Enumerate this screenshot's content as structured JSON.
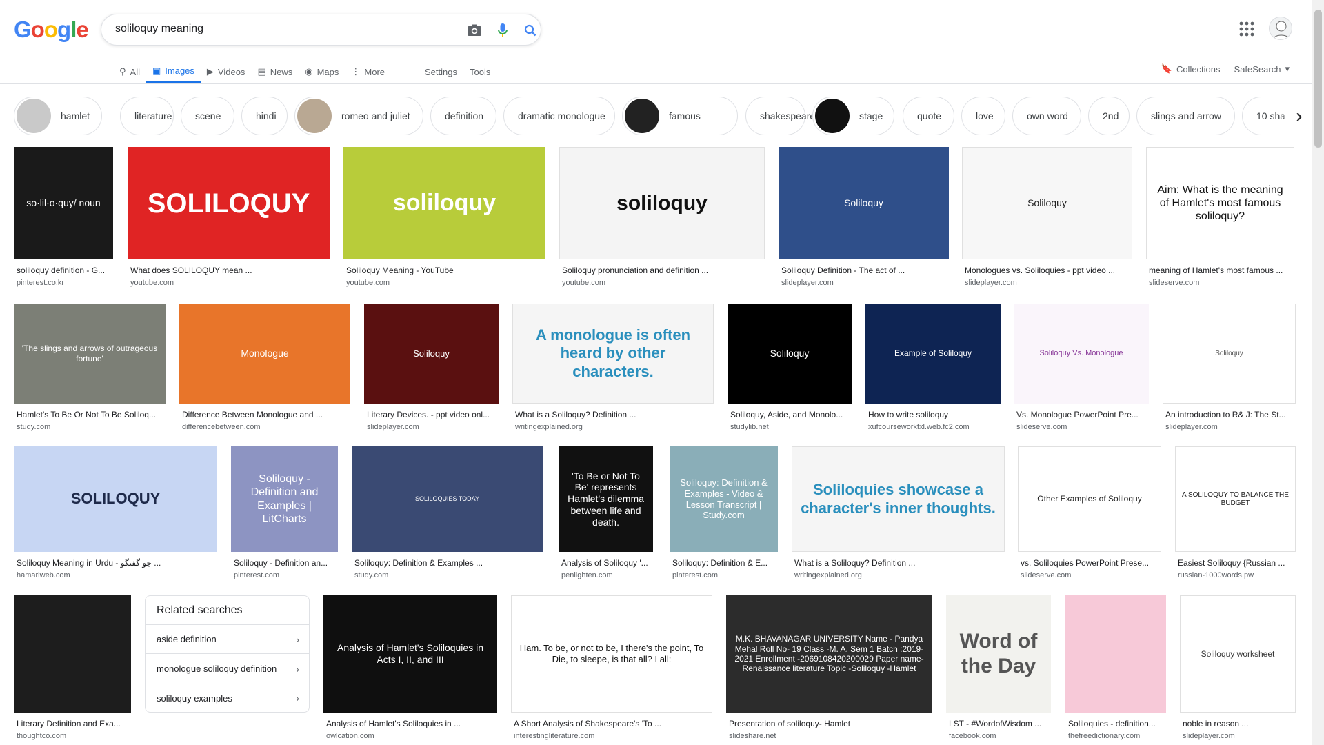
{
  "logo": {
    "letters": [
      "G",
      "o",
      "o",
      "g",
      "l",
      "e"
    ],
    "colors": [
      "#4285F4",
      "#EA4335",
      "#FBBC05",
      "#4285F4",
      "#34A853",
      "#EA4335"
    ]
  },
  "search": {
    "query": "soliloquy meaning"
  },
  "header": {
    "apps_icon": "apps-grid-icon",
    "avatar_icon": "avatar"
  },
  "tabs": [
    {
      "label": "All",
      "icon": "search-icon"
    },
    {
      "label": "Images",
      "icon": "image-icon",
      "active": true
    },
    {
      "label": "Videos",
      "icon": "video-icon"
    },
    {
      "label": "News",
      "icon": "news-icon"
    },
    {
      "label": "Maps",
      "icon": "map-icon"
    },
    {
      "label": "More",
      "icon": "more-vert-icon"
    }
  ],
  "tools": {
    "settings": "Settings",
    "tools": "Tools"
  },
  "right_links": {
    "collections": "Collections",
    "safesearch": "SafeSearch"
  },
  "chips": [
    {
      "label": "hamlet",
      "thumb": "#c9c9c9"
    },
    {
      "label": "literature"
    },
    {
      "label": "scene"
    },
    {
      "label": "hindi"
    },
    {
      "label": "romeo and juliet",
      "thumb": "#b9a893"
    },
    {
      "label": "definition"
    },
    {
      "label": "dramatic monologue"
    },
    {
      "label": "famous",
      "thumb": "#222222"
    },
    {
      "label": "shakespeare"
    },
    {
      "label": "stage",
      "thumb": "#111111"
    },
    {
      "label": "quote"
    },
    {
      "label": "love"
    },
    {
      "label": "own word"
    },
    {
      "label": "2nd"
    },
    {
      "label": "slings and arrow"
    },
    {
      "label": "10 sha"
    }
  ],
  "results": [
    {
      "title": "soliloquy definition - G...",
      "source": "pinterest.co.kr",
      "thumb_text": "so·lil·o·quy/ noun",
      "bg": "#1a1a1a",
      "fg": "#ffffff"
    },
    {
      "title": "What does SOLILOQUY mean ...",
      "source": "youtube.com",
      "thumb_text": "SOLILOQUY",
      "bg": "#e02424",
      "fg": "#ffffff"
    },
    {
      "title": "Soliloquy Meaning - YouTube",
      "source": "youtube.com",
      "thumb_text": "soliloquy",
      "bg": "#b8cc3a",
      "fg": "#ffffff"
    },
    {
      "title": "Soliloquy pronunciation and definition ...",
      "source": "youtube.com",
      "thumb_text": "soliloquy",
      "bg": "#f4f4f4",
      "fg": "#111111"
    },
    {
      "title": "Soliloquy Definition - The act of ...",
      "source": "slideplayer.com",
      "thumb_text": "Soliloquy",
      "bg": "#2f4f8a",
      "fg": "#ffffff"
    },
    {
      "title": "Monologues vs. Soliloquies - ppt video ...",
      "source": "slideplayer.com",
      "thumb_text": "Soliloquy",
      "bg": "#f7f7f7",
      "fg": "#222222"
    },
    {
      "title": "meaning of Hamlet's most famous ...",
      "source": "slideserve.com",
      "thumb_text": "Aim: What is the meaning of Hamlet's most famous soliloquy?",
      "bg": "#ffffff",
      "fg": "#111111"
    },
    {
      "title": "Hamlet's To Be Or Not To Be Soliloq...",
      "source": "study.com",
      "thumb_text": "'The slings and arrows of outrageous fortune'",
      "bg": "#7c7f76",
      "fg": "#ffffff"
    },
    {
      "title": "Difference Between Monologue and ...",
      "source": "differencebetween.com",
      "thumb_text": "Monologue",
      "bg": "#e8752a",
      "fg": "#ffffff"
    },
    {
      "title": "Literary Devices. - ppt video onl...",
      "source": "slideplayer.com",
      "thumb_text": "Soliloquy",
      "bg": "#5a1010",
      "fg": "#ffffff"
    },
    {
      "title": "What is a Soliloquy? Definition ...",
      "source": "writingexplained.org",
      "thumb_text": "A monologue is often heard by other characters.",
      "bg": "#f5f5f5",
      "fg": "#2a8fbd"
    },
    {
      "title": "Soliloquy, Aside, and Monolo...",
      "source": "studylib.net",
      "thumb_text": "Soliloquy",
      "bg": "#000000",
      "fg": "#ffffff"
    },
    {
      "title": "How to write soliloquy",
      "source": "xufcourseworkfxl.web.fc2.com",
      "thumb_text": "Example of Soliloquy",
      "bg": "#0e2453",
      "fg": "#ffffff"
    },
    {
      "title": "Vs. Monologue PowerPoint Pre...",
      "source": "slideserve.com",
      "thumb_text": "Soliloquy Vs. Monologue",
      "bg": "#faf5fb",
      "fg": "#8a3a9a"
    },
    {
      "title": "An introduction to R& J: The St...",
      "source": "slideplayer.com",
      "thumb_text": "Soliloquy",
      "bg": "#ffffff",
      "fg": "#555555"
    },
    {
      "title": "Soliloquy Meaning in Urdu - جو گفتگو ...",
      "source": "hamariweb.com",
      "thumb_text": "SOLILOQUY",
      "bg": "#c7d6f3",
      "fg": "#1e2a4a"
    },
    {
      "title": "Soliloquy - Definition an...",
      "source": "pinterest.com",
      "thumb_text": "Soliloquy - Definition and Examples | LitCharts",
      "bg": "#8d94c2",
      "fg": "#ffffff"
    },
    {
      "title": "Soliloquy: Definition & Examples ...",
      "source": "study.com",
      "thumb_text": "SOLILOQUIES TODAY",
      "bg": "#3a4a73",
      "fg": "#ffffff"
    },
    {
      "title": "Analysis of Soliloquy '...",
      "source": "penlighten.com",
      "thumb_text": "'To Be or Not To Be' represents Hamlet's dilemma between life and death.",
      "bg": "#111111",
      "fg": "#ffffff"
    },
    {
      "title": "Soliloquy: Definition & E...",
      "source": "pinterest.com",
      "thumb_text": "Soliloquy: Definition & Examples - Video & Lesson Transcript | Study.com",
      "bg": "#8aaeb8",
      "fg": "#ffffff"
    },
    {
      "title": "What is a Soliloquy? Definition ...",
      "source": "writingexplained.org",
      "thumb_text": "Soliloquies showcase a character's inner thoughts.",
      "bg": "#f5f5f5",
      "fg": "#2a8fbd"
    },
    {
      "title": "vs. Soliloquies PowerPoint Prese...",
      "source": "slideserve.com",
      "thumb_text": "Other Examples of Soliloquy",
      "bg": "#ffffff",
      "fg": "#222222"
    },
    {
      "title": "Easiest Soliloquy {Russian ...",
      "source": "russian-1000words.pw",
      "thumb_text": "A SOLILOQUY TO BALANCE THE BUDGET",
      "bg": "#ffffff",
      "fg": "#222222"
    },
    {
      "title": "Literary Definition and Exa...",
      "source": "thoughtco.com",
      "thumb_text": "",
      "bg": "#1d1d1d",
      "fg": "#ffffff"
    },
    {
      "title": "Analysis of Hamlet's Soliloquies in ...",
      "source": "owlcation.com",
      "thumb_text": "Analysis of Hamlet's Soliloquies in Acts I, II, and III",
      "bg": "#0f0f0f",
      "fg": "#ffffff"
    },
    {
      "title": "A Short Analysis of Shakespeare's 'To ...",
      "source": "interestingliterature.com",
      "thumb_text": "Ham. To be, or not to be, I there's the point, To Die, to sleepe, is that all? I all:",
      "bg": "#ffffff",
      "fg": "#111111"
    },
    {
      "title": "Presentation of soliloquy- Hamlet",
      "source": "slideshare.net",
      "thumb_text": "M.K. BHAVANAGAR UNIVERSITY Name - Pandya Mehal Roll No- 19 Class -M. A. Sem 1 Batch :2019-2021 Enrollment -2069108420200029 Paper name-Renaissance literature Topic -Soliloquy -Hamlet",
      "bg": "#2c2c2c",
      "fg": "#ffffff"
    },
    {
      "title": "LST - #WordofWisdom ...",
      "source": "facebook.com",
      "thumb_text": "Word of the Day",
      "bg": "#f2f2ee",
      "fg": "#555555"
    },
    {
      "title": "Soliloquies - definition...",
      "source": "thefreedictionary.com",
      "thumb_text": "",
      "bg": "#f7c9d8",
      "fg": "#222222"
    },
    {
      "title": "noble in reason ...",
      "source": "slideplayer.com",
      "thumb_text": "Soliloquy worksheet",
      "bg": "#ffffff",
      "fg": "#333333"
    }
  ],
  "related": {
    "heading": "Related searches",
    "items": [
      "aside definition",
      "monologue soliloquy definition",
      "soliloquy examples"
    ]
  }
}
